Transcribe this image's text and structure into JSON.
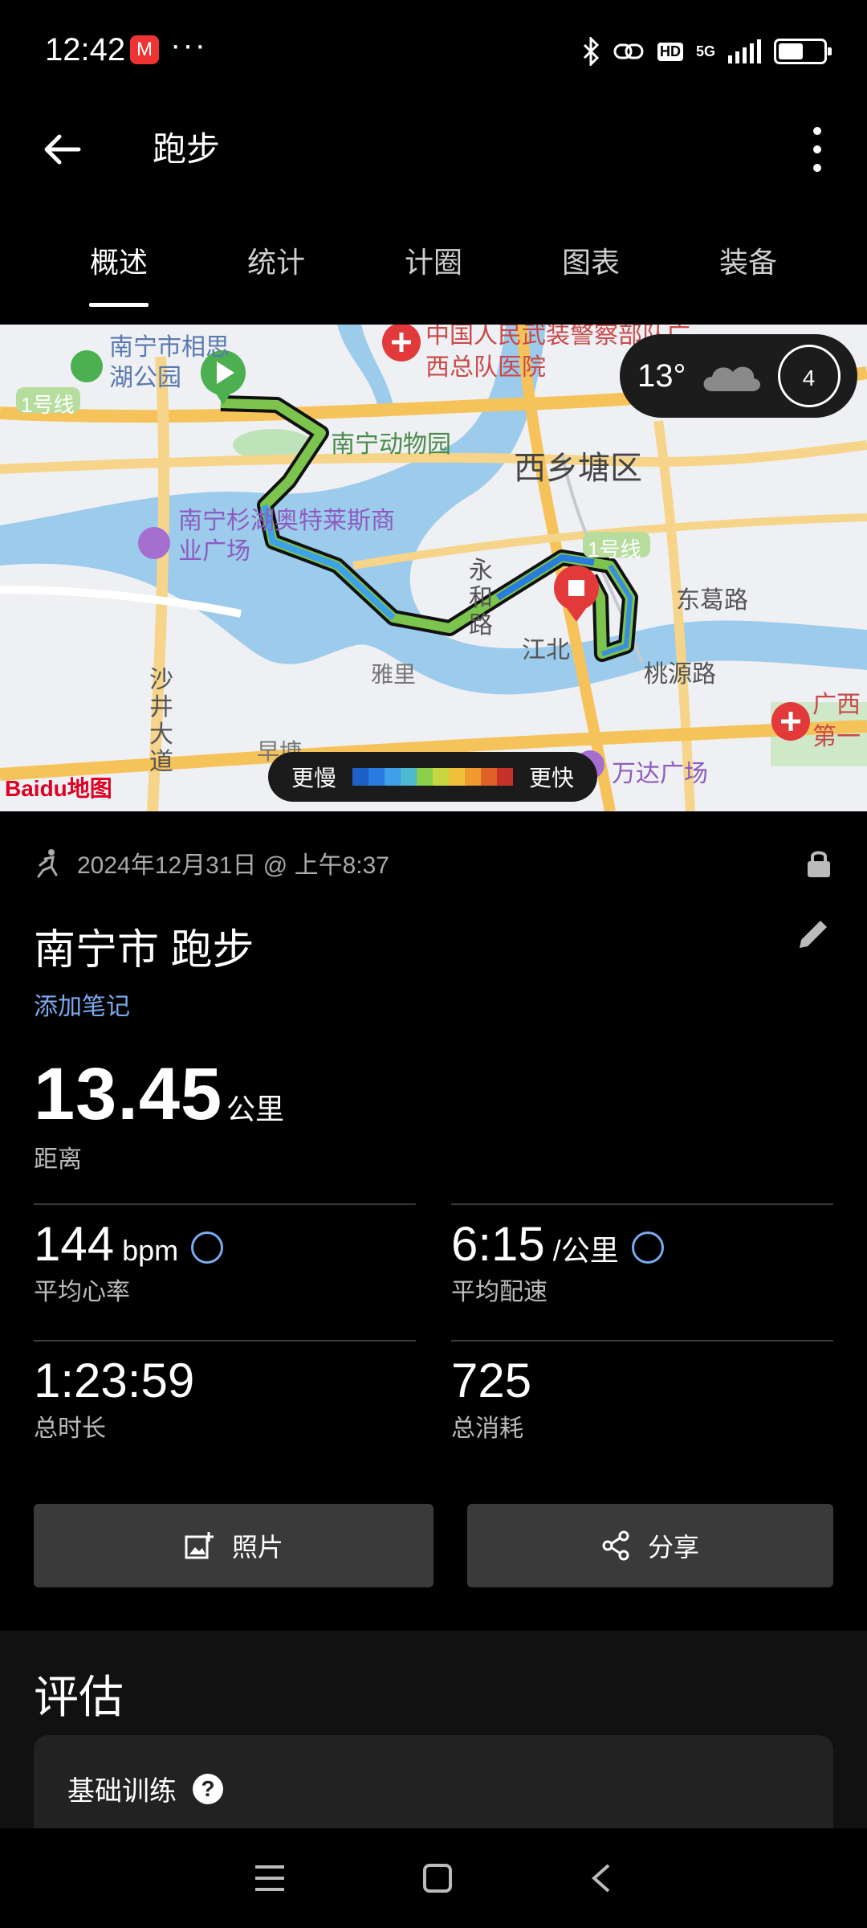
{
  "status_bar": {
    "time": "12:42",
    "more": "···",
    "hd_label": "HD",
    "net_label": "5G",
    "battery_level": 0.55
  },
  "header": {
    "title": "跑步"
  },
  "tabs": [
    {
      "label": "概述",
      "active": true
    },
    {
      "label": "统计",
      "active": false
    },
    {
      "label": "计圈",
      "active": false
    },
    {
      "label": "图表",
      "active": false
    },
    {
      "label": "装备",
      "active": false
    }
  ],
  "map": {
    "weather": {
      "temperature": "13°",
      "icon": "cloud-icon",
      "badge": "4"
    },
    "legend": {
      "slower": "更慢",
      "faster": "更快",
      "colors": [
        "#1f5fc8",
        "#2a7be0",
        "#3ea0e8",
        "#4dbad0",
        "#8ccf4a",
        "#c8d640",
        "#f0c23a",
        "#ee9a2e",
        "#e0602a",
        "#c8302a"
      ]
    },
    "labels": [
      "南宁市相思湖公园",
      "中国人民武装警察部队广西总队医院",
      "1号线",
      "南宁动物园",
      "西乡塘区",
      "南宁杉湖奥特莱斯商业广场",
      "1号线",
      "东葛路",
      "永和路",
      "江北",
      "桃源路",
      "雅里",
      "沙井大道",
      "早塘",
      "万达广场",
      "广西第一"
    ],
    "provider": "Baidu地图"
  },
  "activity": {
    "datetime": "2024年12月31日 @ 上午8:37",
    "title": "南宁市 跑步",
    "add_note": "添加笔记",
    "distance": {
      "value": "13.45",
      "unit": "公里",
      "label": "距离"
    },
    "stats": [
      {
        "value": "144",
        "unit": "bpm",
        "label": "平均心率"
      },
      {
        "value": "6:15",
        "unit": "/公里",
        "label": "平均配速"
      },
      {
        "value": "1:23:59",
        "unit": "",
        "label": "总时长"
      },
      {
        "value": "725",
        "unit": "",
        "label": "总消耗"
      }
    ]
  },
  "actions": {
    "photo": "照片",
    "share": "分享"
  },
  "evaluation": {
    "title": "评估",
    "card_title": "基础训练",
    "help": "?"
  }
}
